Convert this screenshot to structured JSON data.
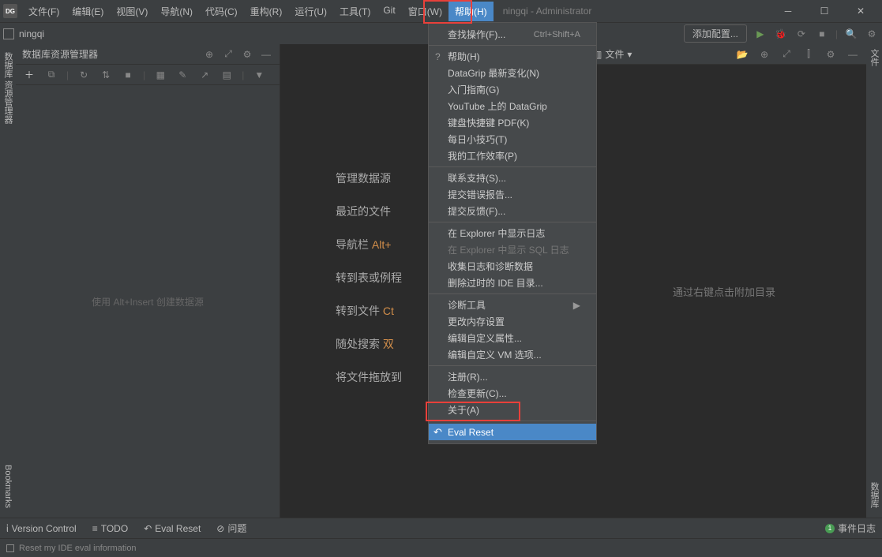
{
  "titlebar": {
    "logo": "DG",
    "menus": [
      "文件(F)",
      "编辑(E)",
      "视图(V)",
      "导航(N)",
      "代码(C)",
      "重构(R)",
      "运行(U)",
      "工具(T)",
      "Git",
      "窗口(W)",
      "帮助(H)"
    ],
    "title": "ningqi - Administrator"
  },
  "crumb": {
    "project": "ningqi"
  },
  "toolbar": {
    "add_config": "添加配置..."
  },
  "left_tabs": {
    "top": "数据库 资源管理器",
    "bottom": "Bookmarks"
  },
  "sidepanel": {
    "title": "数据库资源管理器",
    "empty_hint": "使用 Alt+Insert 创建数据源"
  },
  "hints": [
    {
      "label": "管理数据源"
    },
    {
      "label": "最近的文件"
    },
    {
      "label": "导航栏  ",
      "key": "Alt+"
    },
    {
      "label": "转到表或例程"
    },
    {
      "label": "转到文件  ",
      "key": "Ct"
    },
    {
      "label": "随处搜索  ",
      "key": "双"
    },
    {
      "label": "将文件拖放到"
    }
  ],
  "right": {
    "tab_label": "文件",
    "empty_hint": "通过右键点击附加目录"
  },
  "right_tabs": {
    "top": "文件",
    "bottom": "数据库"
  },
  "dropdown": {
    "find_action": "查找操作(F)...",
    "find_action_sc": "Ctrl+Shift+A",
    "help": "帮助(H)",
    "whatsnew": "DataGrip 最新变化(N)",
    "getting": "入门指南(G)",
    "youtube": "YouTube 上的 DataGrip",
    "keymap": "键盘快捷键 PDF(K)",
    "tips": "每日小技巧(T)",
    "productivity": "我的工作效率(P)",
    "contact": "联系支持(S)...",
    "submit_bug": "提交错误报告...",
    "feedback": "提交反馈(F)...",
    "show_log": "在 Explorer 中显示日志",
    "show_sql_log": "在 Explorer 中显示 SQL 日志",
    "collect": "收集日志和诊断数据",
    "delete_dir": "删除过时的 IDE 目录...",
    "diag": "诊断工具",
    "memory": "更改内存设置",
    "custom_props": "编辑自定义属性...",
    "custom_vm": "编辑自定义 VM 选项...",
    "register": "注册(R)...",
    "check_update": "检查更新(C)...",
    "about": "关于(A)",
    "eval_reset": "Eval Reset"
  },
  "bottombar": {
    "vc": "Version Control",
    "todo": "TODO",
    "eval": "Eval Reset",
    "problems": "问题",
    "eventlog": "事件日志"
  },
  "statusbar": {
    "text": "Reset my IDE eval information"
  }
}
